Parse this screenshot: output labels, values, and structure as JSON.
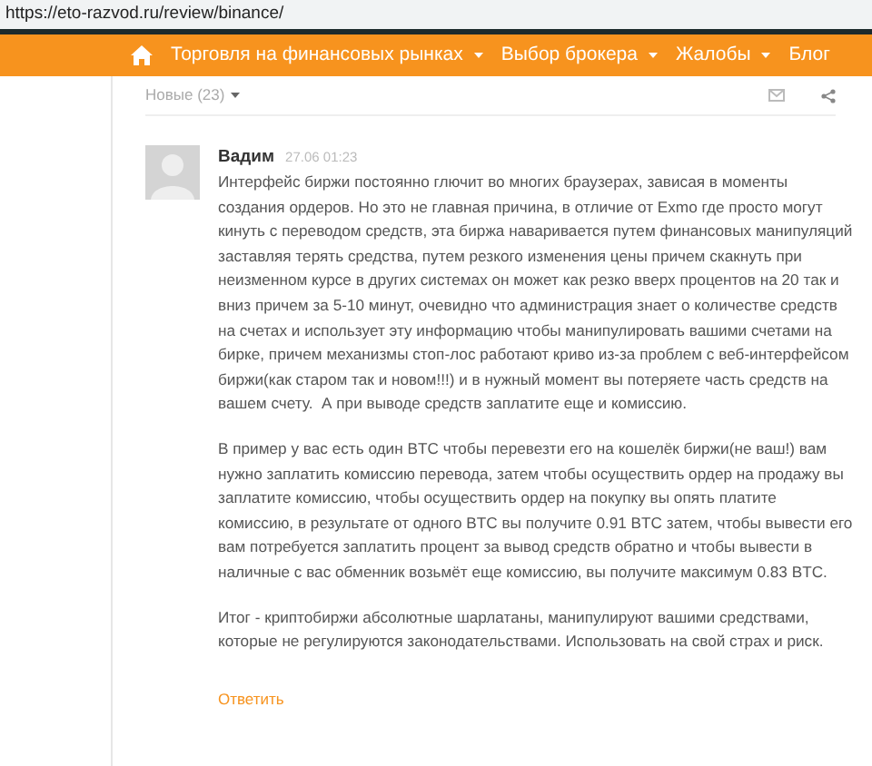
{
  "address_bar": {
    "url": "https://eto-razvod.ru/review/binance/"
  },
  "nav": {
    "items": [
      {
        "label": "Торговля на финансовых рынках",
        "has_dropdown": true
      },
      {
        "label": "Выбор брокера",
        "has_dropdown": true
      },
      {
        "label": "Жалобы",
        "has_dropdown": true
      },
      {
        "label": "Блог",
        "has_dropdown": false
      }
    ]
  },
  "sort": {
    "label": "Новые (23)"
  },
  "comment": {
    "author": "Вадим",
    "time": "27.06 01:23",
    "paragraphs": [
      "Интерфейс биржи постоянно глючит во многих браузерах, зависая в моменты создания ордеров. Но это не главная причина, в отличие от Exmo где просто могут кинуть с переводом средств, эта биржа наваривается путем финансовых манипуляций заставляя терять средства, путем резкого изменения цены причем скакнуть при неизменном курсе в других системах он может как резко вверх процентов на 20 так и вниз причем за 5-10 минут, очевидно что администрация знает о количестве средств на счетах и использует эту информацию чтобы манипулировать вашими счетами на бирке, причем механизмы стоп-лос работают криво из-за проблем с веб-интерфейсом биржи(как старом так и новом!!!) и в нужный момент вы потеряете часть средств на вашем счету.  А при выводе средств заплатите еще и комиссию.",
      "В пример у вас есть один BTC чтобы перевезти его на кошелёк биржи(не ваш!) вам нужно заплатить комиссию перевода, затем чтобы осуществить ордер на продажу вы заплатите комиссию, чтобы осуществить ордер на покупку вы опять платите комиссию, в результате от одного BTC вы получите 0.91 BTC затем, чтобы вывести его вам потребуется заплатить процент за вывод средств обратно и чтобы вывести в наличные с вас обменник возьмёт еще комиссию, вы получите максимум 0.83 BTC.",
      "Итог - криптобиржи абсолютные шарлатаны, манипулируют вашими средствами, которые не регулируются законодательствами. Использовать на свой страх и риск."
    ],
    "reply": "Ответить"
  }
}
